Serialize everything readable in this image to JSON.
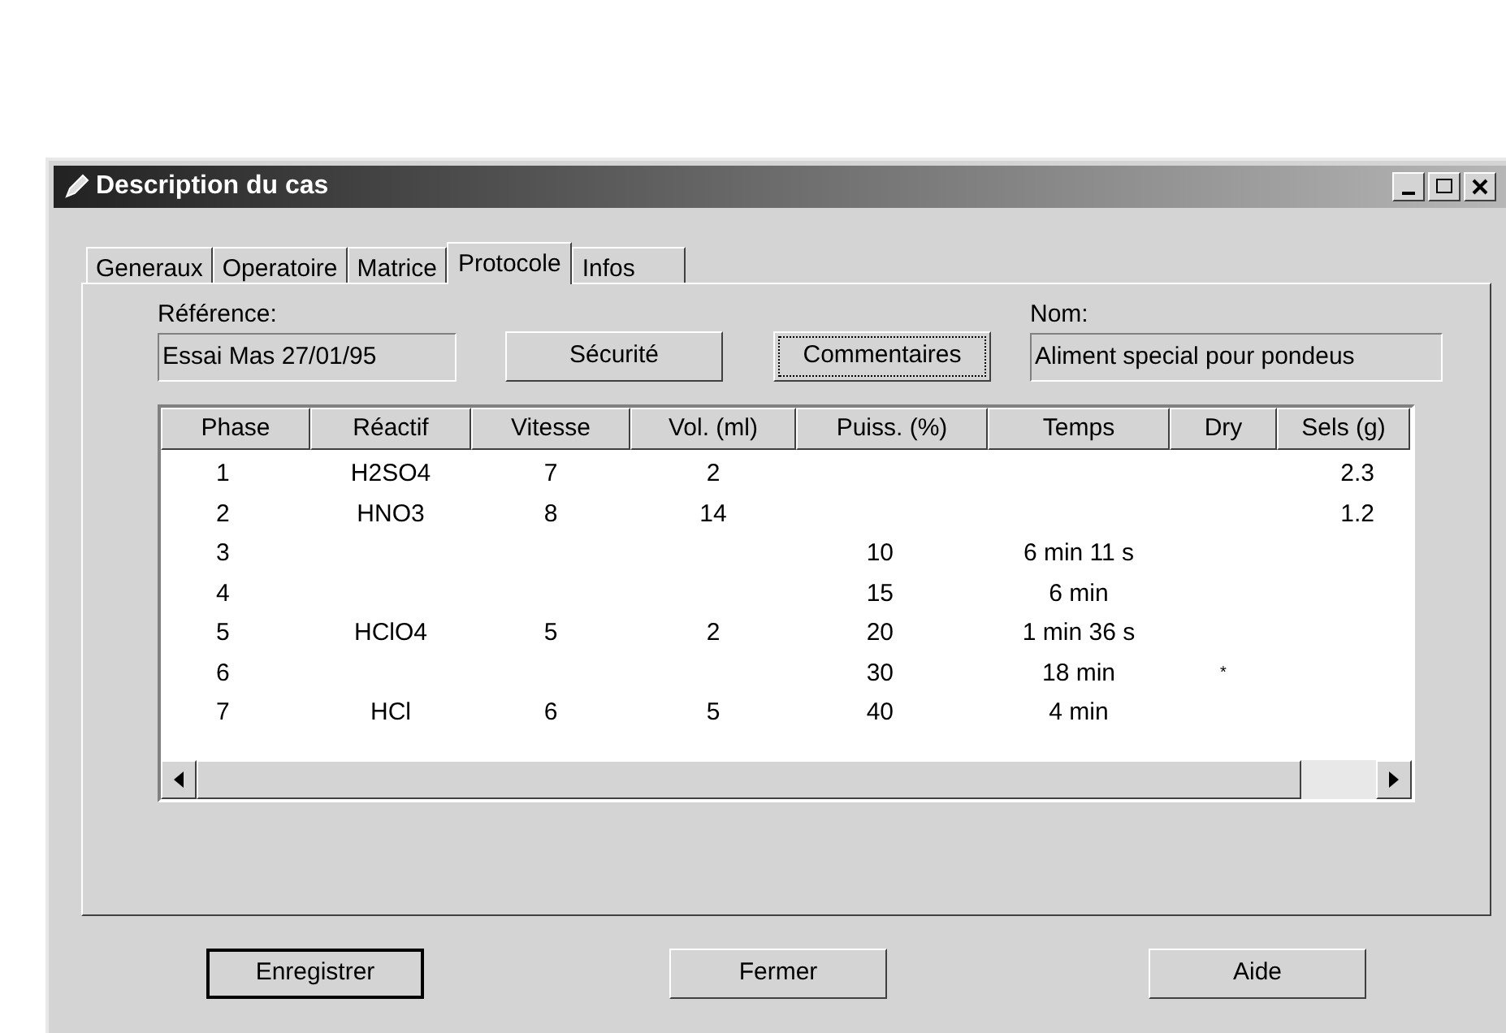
{
  "window": {
    "title": "Description du cas"
  },
  "tabs": [
    {
      "label": "Generaux",
      "selected": false
    },
    {
      "label": "Operatoire",
      "selected": false
    },
    {
      "label": "Matrice",
      "selected": false
    },
    {
      "label": "Protocole",
      "selected": true
    },
    {
      "label": "Infos",
      "selected": false
    }
  ],
  "reference": {
    "label": "Référence:",
    "value": "Essai Mas 27/01/95"
  },
  "securite_button": {
    "label": "Sécurité",
    "focused": false
  },
  "commentaires_button": {
    "label": "Commentaires",
    "focused": true
  },
  "nom": {
    "label": "Nom:",
    "value": "Aliment special pour pondeus"
  },
  "table": {
    "columns": [
      "Phase",
      "Réactif",
      "Vitesse",
      "Vol. (ml)",
      "Puiss. (%)",
      "Temps",
      "Dry",
      "Sels (g)"
    ],
    "rows": [
      [
        "1",
        "H2SO4",
        "7",
        "2",
        "",
        "",
        "",
        "2.3"
      ],
      [
        "2",
        "HNO3",
        "8",
        "14",
        "",
        "",
        "",
        "1.2"
      ],
      [
        "3",
        "",
        "",
        "",
        "10",
        "6 min 11 s",
        "",
        ""
      ],
      [
        "4",
        "",
        "",
        "",
        "15",
        "6 min",
        "",
        ""
      ],
      [
        "5",
        "HClO4",
        "5",
        "2",
        "20",
        "1 min 36 s",
        "",
        ""
      ],
      [
        "6",
        "",
        "",
        "",
        "30",
        "18 min",
        "*",
        ""
      ],
      [
        "7",
        "HCl",
        "6",
        "5",
        "40",
        "4 min",
        "",
        ""
      ]
    ]
  },
  "buttons": [
    {
      "label": "Enregistrer",
      "default": true
    },
    {
      "label": "Fermer",
      "default": false
    },
    {
      "label": "Aide",
      "default": false
    }
  ]
}
